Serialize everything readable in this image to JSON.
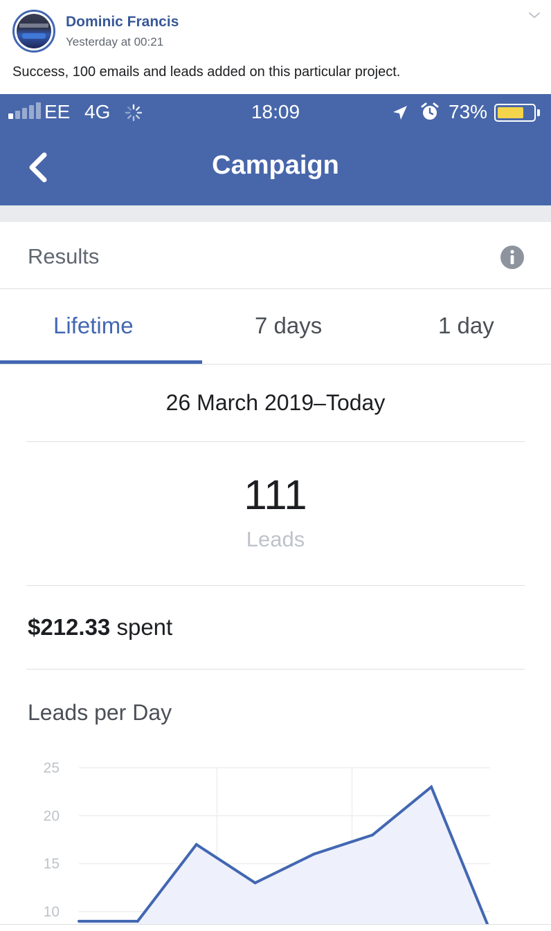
{
  "post": {
    "author": "Dominic Francis",
    "timestamp": "Yesterday at 00:21",
    "text": "Success, 100 emails and leads added on this particular project."
  },
  "status_bar": {
    "carrier": "EE",
    "network": "4G",
    "time": "18:09",
    "battery_percent": "73%",
    "battery_level": 0.73
  },
  "nav": {
    "title": "Campaign"
  },
  "results": {
    "label": "Results"
  },
  "tabs": [
    {
      "label": "Lifetime",
      "active": true
    },
    {
      "label": "7 days",
      "active": false
    },
    {
      "label": "1 day",
      "active": false
    }
  ],
  "date_range": "26 March 2019–Today",
  "metric": {
    "value": "111",
    "label": "Leads"
  },
  "spent": {
    "amount": "$212.33",
    "suffix": " spent"
  },
  "chart_data": {
    "type": "area",
    "title": "Leads per Day",
    "xlabel": "",
    "ylabel": "",
    "y_ticks": [
      "25",
      "20",
      "15",
      "10"
    ],
    "ylim": [
      10,
      25
    ],
    "x": [
      0,
      1,
      2,
      3,
      4,
      5,
      6,
      7
    ],
    "values": [
      9,
      9,
      17,
      13,
      16,
      18,
      23,
      8
    ],
    "grid": true,
    "line_color": "#4267b2",
    "fill_color": "#eef0fb"
  },
  "colors": {
    "brand_blue": "#4867aa",
    "accent": "#4267b2"
  }
}
